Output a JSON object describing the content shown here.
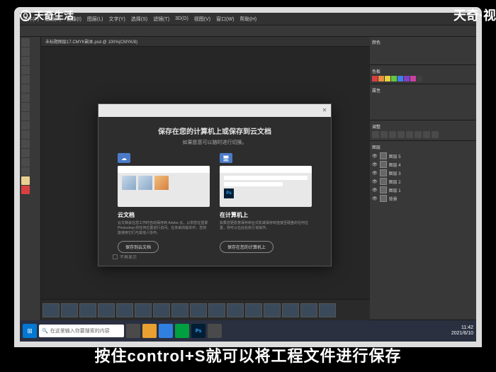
{
  "watermarks": {
    "topLeft": "天奇生活",
    "topRight": "天奇·视",
    "subtitle": "按住control+S就可以将工程文件进行保存"
  },
  "menubar": {
    "items": [
      "文件(F)",
      "编辑(E)",
      "图像(I)",
      "图层(L)",
      "文字(Y)",
      "选择(S)",
      "滤镜(T)",
      "3D(D)",
      "视图(V)",
      "窗口(W)",
      "帮助(H)"
    ]
  },
  "docTab": "未标题图层17.CMYK副本.psd @ 100%(CMYK/8)",
  "dialog": {
    "title": "保存在您的计算机上或保存到云文档",
    "subtitle": "如果愿意可以随时进行切换。",
    "optionA": {
      "title": "云文档",
      "desc": "云文档会在您工作时自动保存到 Adobe 云，以供您在登录 Photoshop 的任何位置进行访问。在未来的版本中，您将能使用它们与其他人协作。",
      "button": "保存到云文档"
    },
    "optionB": {
      "title": "在计算机上",
      "desc": "如果您更愿意保存到台式机或保存到连接至硬盘的任何位置，则可以在此处执行该操作。",
      "button": "保存在您的计算机上"
    },
    "footer": "不再显示"
  },
  "panels": {
    "color": "颜色",
    "swatches": "色板",
    "properties": "属性",
    "adjustments": "调整",
    "layers": "图层",
    "layerItems": [
      "图层 5",
      "图层 4",
      "图层 3",
      "图层 2",
      "图层 1",
      "背景"
    ]
  },
  "swatchColors": [
    "#d84040",
    "#e89040",
    "#e8d040",
    "#60c840",
    "#4080e8",
    "#8040c8",
    "#c840a0",
    "#404040"
  ],
  "taskbar": {
    "searchPlaceholder": "在这里输入你要搜索的内容",
    "time": "11:42",
    "date": "2021/6/10"
  }
}
